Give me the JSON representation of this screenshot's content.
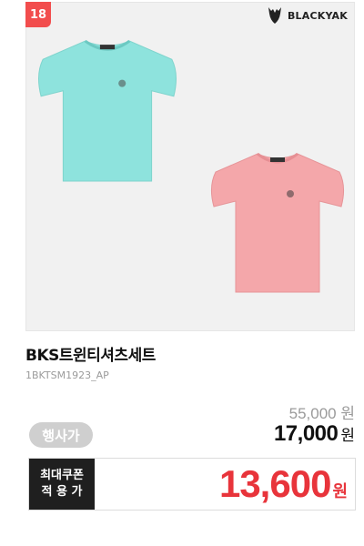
{
  "rank": {
    "number": "18"
  },
  "brand": {
    "name": "BLACKYAK"
  },
  "product": {
    "title": "BKS트윈티셔츠세트",
    "code": "1BKTSM1923_AP",
    "image_alt": "mint and pink t-shirts"
  },
  "pricing": {
    "original_price": "55,000",
    "original_unit": "원",
    "event_badge": "행사가",
    "sale_price": "17,000",
    "sale_unit": "원",
    "coupon_label_line1": "최대쿠폰",
    "coupon_label_line2": "적 용 가",
    "coupon_price": "13,600",
    "coupon_unit": "원"
  },
  "colors": {
    "badge_red": "#f24d4d",
    "mint_shirt": "#8ee3dd",
    "pink_shirt": "#f4a7aa",
    "coupon_red": "#e8343b"
  },
  "icons": {
    "brand_logo": "yak-head-icon"
  }
}
